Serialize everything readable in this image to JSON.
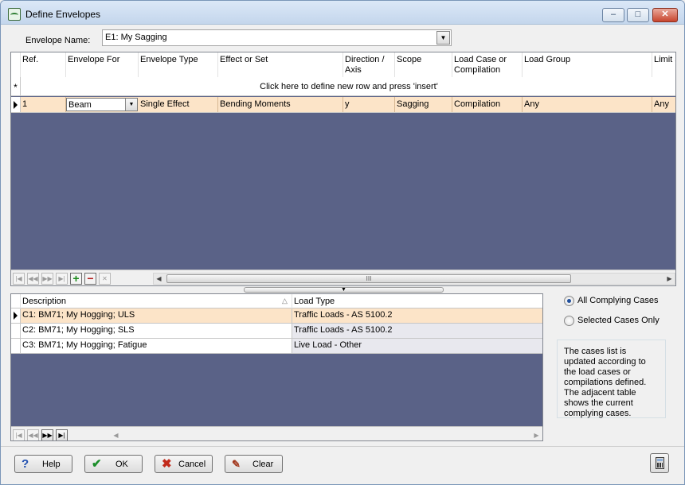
{
  "window": {
    "title": "Define Envelopes",
    "controls": {
      "minimize": "–",
      "maximize": "□",
      "close": "✕"
    }
  },
  "envelope_name": {
    "label": "Envelope Name:",
    "value": "E1: My Sagging"
  },
  "envelopes_grid": {
    "columns": [
      "Ref.",
      "Envelope For",
      "Envelope Type",
      "Effect or Set",
      "Direction / Axis",
      "Scope",
      "Load Case or Compilation",
      "Load Group",
      "Limit S"
    ],
    "new_row_marker": "*",
    "new_row_text": "Click here to define new row and press 'insert'",
    "rows": [
      {
        "ref": "1",
        "envelope_for": "Beam",
        "envelope_type": "Single Effect",
        "effect_or_set": "Bending Moments",
        "direction": "y",
        "scope": "Sagging",
        "load_case": "Compilation",
        "load_group": "Any",
        "limit": "Any"
      }
    ],
    "scroll_thumb": "III"
  },
  "cases_grid": {
    "columns": [
      "Description",
      "Load Type"
    ],
    "rows": [
      {
        "description": "C1: BM71; My Hogging; ULS",
        "load_type": "Traffic Loads - AS 5100.2"
      },
      {
        "description": "C2: BM71; My Hogging; SLS",
        "load_type": "Traffic Loads - AS 5100.2"
      },
      {
        "description": "C3: BM71; My Hogging; Fatigue",
        "load_type": "Live Load - Other"
      }
    ]
  },
  "options": {
    "all_complying": "All Complying Cases",
    "selected_only": "Selected Cases Only",
    "selected": "all_complying",
    "info": "The cases list is updated according to the load cases or compilations defined.  The adjacent table shows the current complying cases."
  },
  "buttons": {
    "help": "Help",
    "ok": "OK",
    "cancel": "Cancel",
    "clear": "Clear"
  },
  "icons": {
    "help": "question-icon",
    "ok": "checkmark-icon",
    "cancel": "cross-icon",
    "clear": "broom-icon",
    "calculator": "calculator-icon"
  }
}
